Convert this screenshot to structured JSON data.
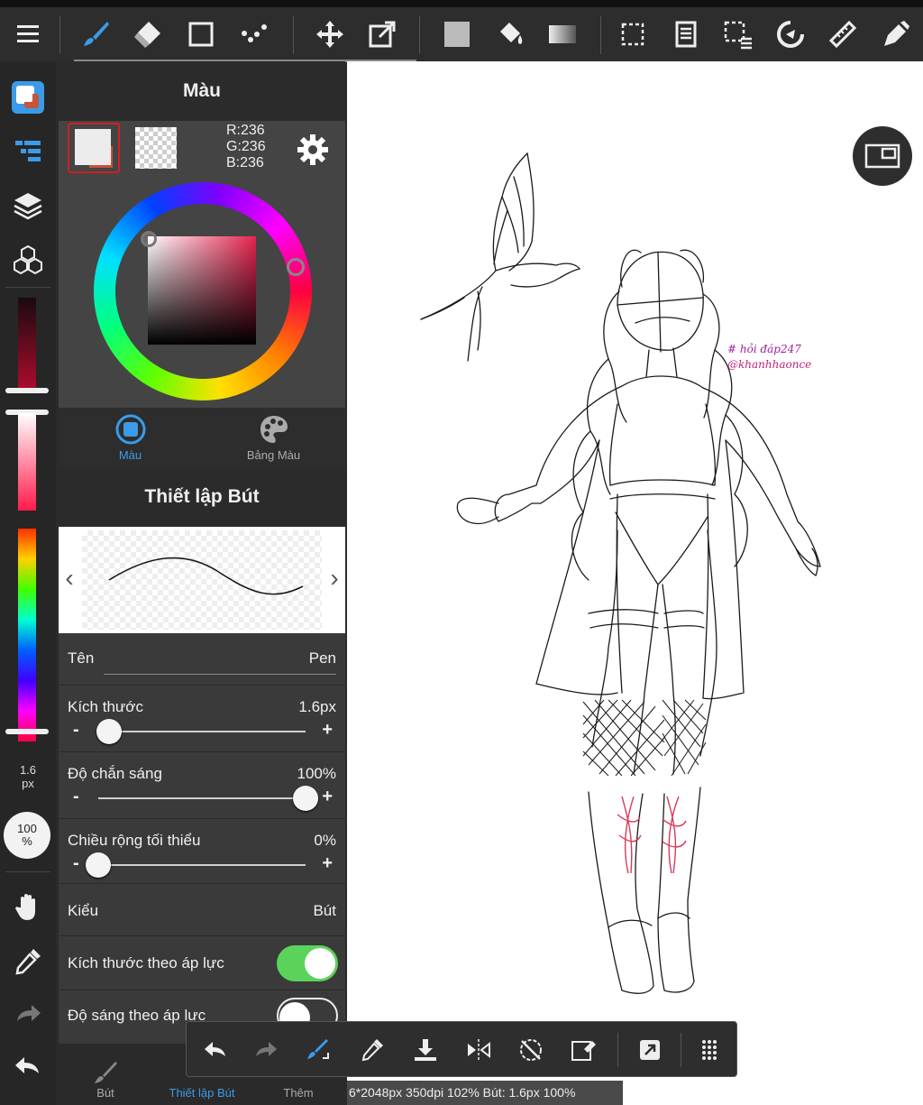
{
  "colors": {
    "accent": "#3b9be8",
    "toggle_on": "#5bd35b",
    "toggle_off": "#3a3a3a",
    "stroke": "#1a1a1a",
    "signature": "#c0207a"
  },
  "topbar": {
    "tools": [
      "menu-icon",
      "brush-icon",
      "eraser-icon",
      "rectangle-icon",
      "dots-icon",
      "move-icon",
      "transform-icon",
      "fill-color-icon",
      "bucket-icon",
      "gradient-icon",
      "select-icon",
      "copy-icon",
      "lasso-select-icon",
      "rotate-icon",
      "ruler-icon",
      "pen-icon"
    ]
  },
  "rail": {
    "size": "1.6",
    "size_unit": "px",
    "opacity": "100",
    "opacity_unit": "%"
  },
  "color_panel": {
    "title": "Màu",
    "rgb": {
      "r": "R:236",
      "g": "G:236",
      "b": "B:236"
    },
    "tabs": [
      {
        "label": "Màu",
        "active": true
      },
      {
        "label": "Bảng Màu",
        "active": false
      }
    ]
  },
  "pen_settings": {
    "title": "Thiết lập Bút",
    "name": {
      "label": "Tên",
      "value": "Pen"
    },
    "size": {
      "label": "Kích thước",
      "value": "1.6px",
      "level": 0.05
    },
    "opacity": {
      "label": "Độ chắn sáng",
      "value": "100%",
      "level": 1.0
    },
    "min_width": {
      "label": "Chiều rộng tối thiểu",
      "value": "0%",
      "level": 0.0
    },
    "style": {
      "label": "Kiểu",
      "value": "Bút"
    },
    "size_pressure": {
      "label": "Kích thước theo áp lực",
      "on": true
    },
    "opacity_pressure": {
      "label": "Độ sáng theo áp lực",
      "on": false
    },
    "minus": "-",
    "plus": "+"
  },
  "panel_tabs": [
    {
      "label": "Bút",
      "active": false
    },
    {
      "label": "Thiết lập Bút",
      "active": true
    },
    {
      "label": "Thêm",
      "active": false
    }
  ],
  "canvas": {
    "signature_line1": "# hỏi đáp247",
    "signature_line2": "@khanhhaonce"
  },
  "status": {
    "text": "6*2048px 350dpi 102% Bút: 1.6px 100%"
  }
}
